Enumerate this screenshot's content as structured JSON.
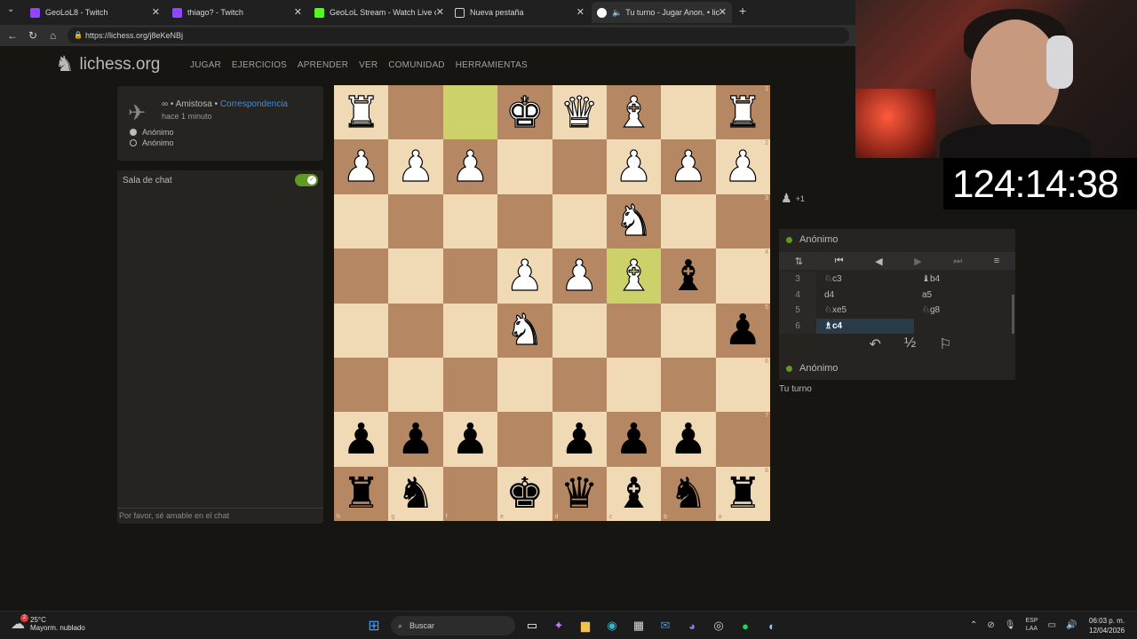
{
  "browser": {
    "tabs": [
      {
        "title": "GeoLoL8 - Twitch",
        "color": "#9146ff"
      },
      {
        "title": "thiago? - Twitch",
        "color": "#9146ff"
      },
      {
        "title": "GeoLoL Stream - Watch Live on Ki",
        "color": "#53fc18"
      },
      {
        "title": "Nueva pestaña",
        "color": "#cfcfcf"
      },
      {
        "title": "Tu turno - Jugar Anon. • liche",
        "color": "#ffffff"
      }
    ],
    "url": "https://lichess.org/j8eKeNBj"
  },
  "header": {
    "logo": "lichess.org",
    "nav": [
      "JUGAR",
      "EJERCICIOS",
      "APRENDER",
      "VER",
      "COMUNIDAD",
      "HERRAMIENTAS"
    ]
  },
  "game_info": {
    "type_prefix": "∞ • Amistosa • ",
    "type_link": "Correspondencia",
    "ago": "hace 1 minuto",
    "players": [
      "Anónimo",
      "Anónimo"
    ]
  },
  "chat": {
    "title": "Sala de chat",
    "placeholder": "Por favor, sé amable en el chat"
  },
  "board": {
    "ranks": [
      "1",
      "2",
      "3",
      "4",
      "5",
      "6",
      "7",
      "8"
    ],
    "files": [
      "h",
      "g",
      "f",
      "e",
      "d",
      "c",
      "b",
      "a"
    ],
    "rows": [
      [
        "wR",
        "",
        "",
        "wK",
        "wQ",
        "wB",
        "",
        "wR"
      ],
      [
        "wP",
        "wP",
        "wP",
        "",
        "",
        "wP",
        "wP",
        "wP"
      ],
      [
        "",
        "",
        "",
        "",
        "",
        "wN",
        "",
        ""
      ],
      [
        "",
        "",
        "",
        "wP",
        "wP",
        "wB",
        "bB",
        ""
      ],
      [
        "",
        "",
        "",
        "wN",
        "",
        "",
        "",
        "bP"
      ],
      [
        "",
        "",
        "",
        "",
        "",
        "",
        "",
        ""
      ],
      [
        "bP",
        "bP",
        "bP",
        "",
        "bP",
        "bP",
        "bP",
        ""
      ],
      [
        "bR",
        "bN",
        "",
        "bK",
        "bQ",
        "bB",
        "bN",
        "bR"
      ]
    ],
    "highlights": [
      [
        0,
        2
      ],
      [
        3,
        5
      ]
    ]
  },
  "right_panel": {
    "spectators": "+1",
    "top_player": "Anónimo",
    "bottom_player": "Anónimo",
    "moves": [
      {
        "num": "3",
        "white": "♘c3",
        "black": "♝b4"
      },
      {
        "num": "4",
        "white": "d4",
        "black": "a5"
      },
      {
        "num": "5",
        "white": "♘xe5",
        "black": "♘g8"
      },
      {
        "num": "6",
        "white": "♗c4",
        "black": ""
      }
    ],
    "turn": "Tu turno"
  },
  "overlay": {
    "timer": "124:14:38"
  },
  "taskbar": {
    "temp": "25°C",
    "weather": "Mayorm. nublado",
    "weather_badge": "2",
    "search": "Buscar",
    "lang_top": "ESP",
    "lang_bottom": "LAA",
    "time": "06:03 p. m.",
    "date": "12/04/2026"
  }
}
